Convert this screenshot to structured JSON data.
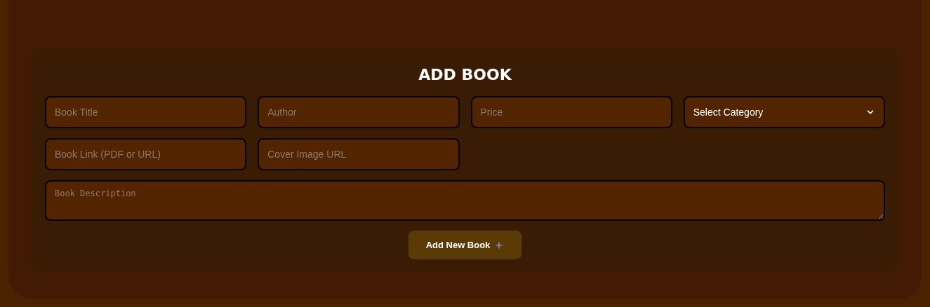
{
  "form": {
    "title": "ADD BOOK",
    "fields": [
      {
        "kind": "input",
        "placeholder": "Book Title"
      },
      {
        "kind": "input",
        "placeholder": "Author"
      },
      {
        "kind": "input",
        "placeholder": "Price"
      },
      {
        "kind": "select",
        "value": "Select Category"
      },
      {
        "kind": "input",
        "placeholder": "Book Link (PDF or URL)"
      },
      {
        "kind": "input",
        "placeholder": "Cover Image URL"
      },
      {
        "kind": "textarea",
        "placeholder": "Book Description"
      }
    ],
    "submit_button": "Add New Book"
  }
}
